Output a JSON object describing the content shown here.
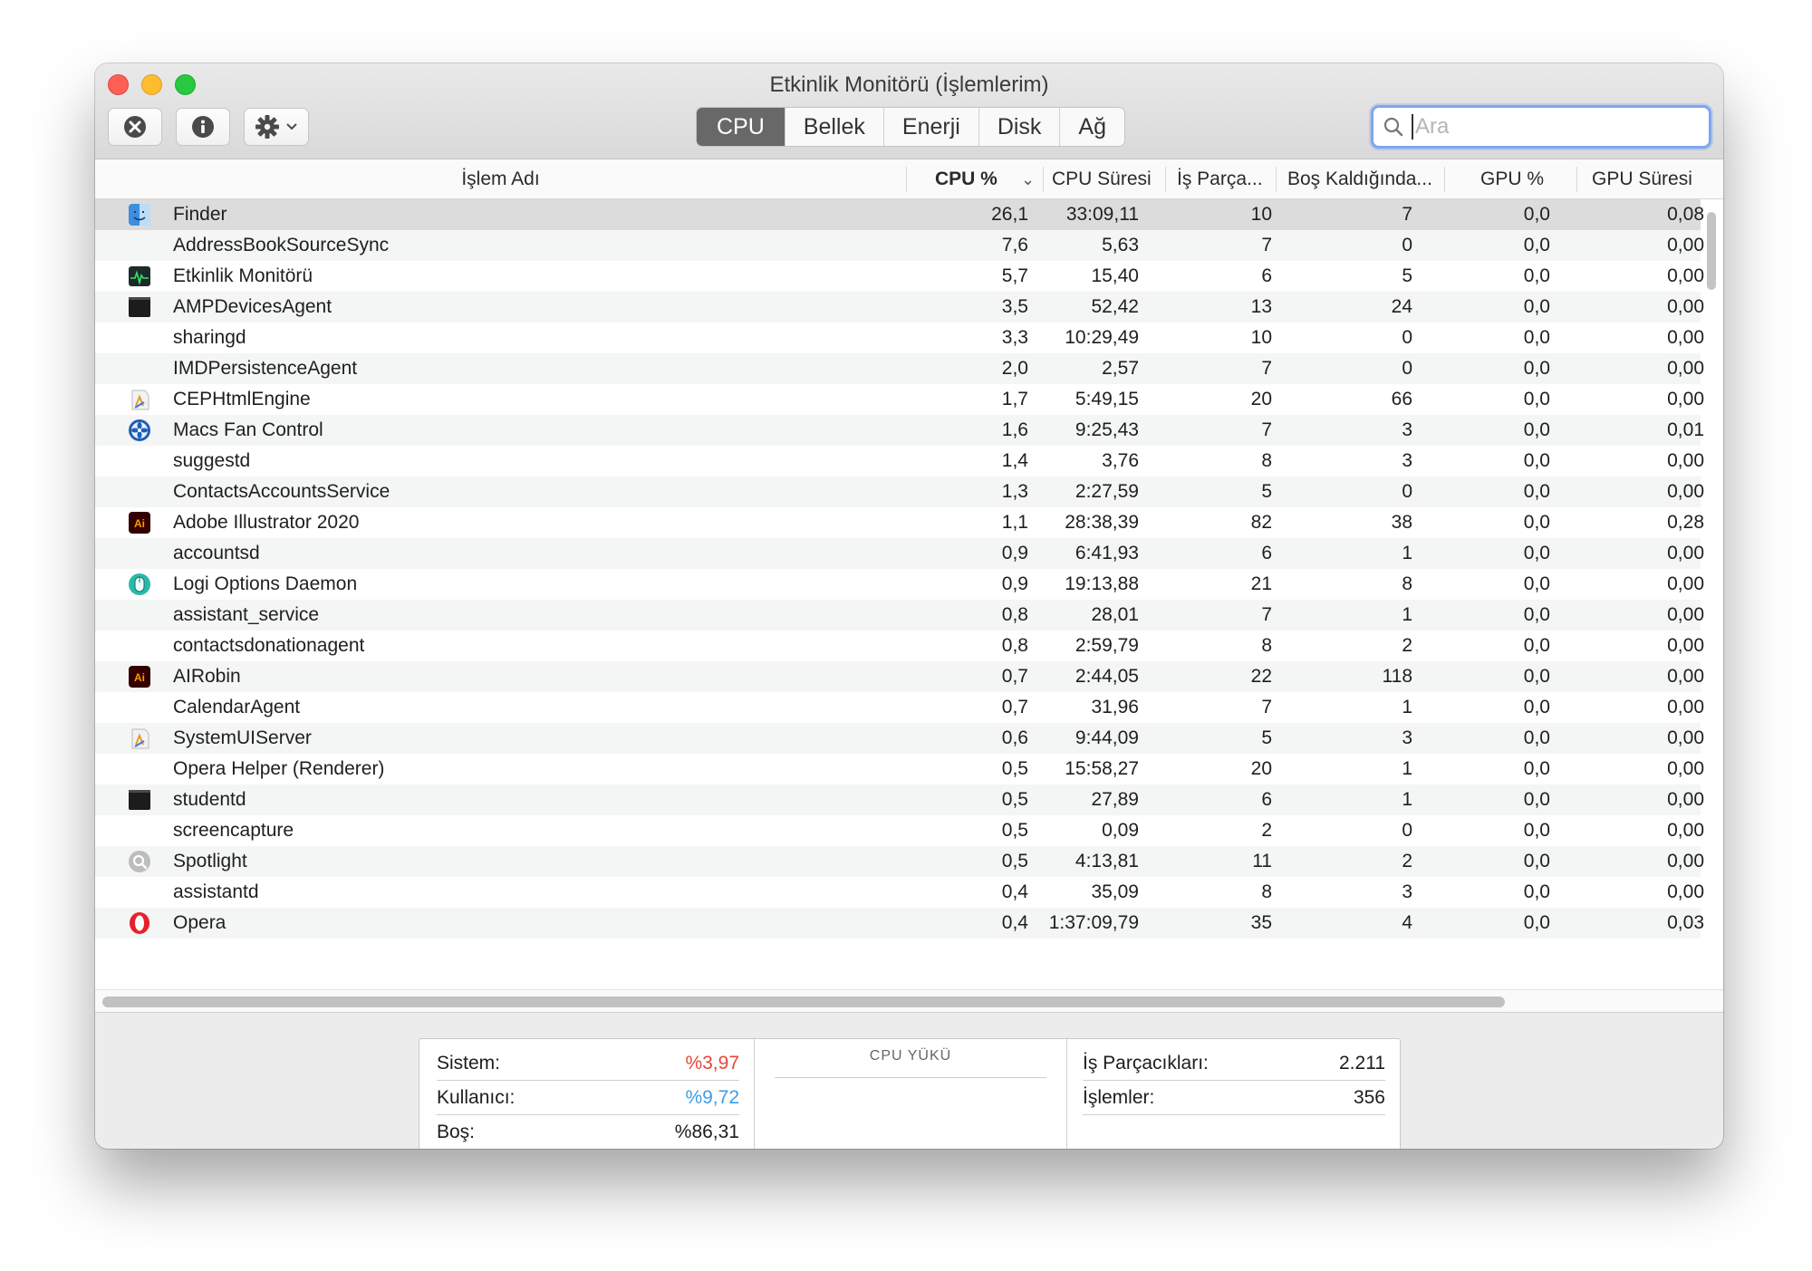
{
  "window": {
    "title": "Etkinlik Monitörü (İşlemlerim)"
  },
  "toolbar": {
    "stop_icon": "x-circle-icon",
    "info_icon": "info-icon",
    "gear_icon": "gear-icon"
  },
  "tabs": [
    {
      "label": "CPU",
      "active": true
    },
    {
      "label": "Bellek",
      "active": false
    },
    {
      "label": "Enerji",
      "active": false
    },
    {
      "label": "Disk",
      "active": false
    },
    {
      "label": "Ağ",
      "active": false
    }
  ],
  "search": {
    "placeholder": "Ara",
    "value": ""
  },
  "columns": {
    "name": "İşlem Adı",
    "cpu": "CPU %",
    "cpu_time": "CPU Süresi",
    "threads": "İş Parça...",
    "idle_wakeups": "Boş Kaldığında...",
    "gpu": "GPU %",
    "gpu_time": "GPU Süresi"
  },
  "processes": [
    {
      "name": "Finder",
      "icon": "finder-icon",
      "cpu": "26,1",
      "cpu_time": "33:09,11",
      "threads": "10",
      "idle": "7",
      "gpu": "0,0",
      "gpu_time": "0,08"
    },
    {
      "name": "AddressBookSourceSync",
      "icon": "",
      "cpu": "7,6",
      "cpu_time": "5,63",
      "threads": "7",
      "idle": "0",
      "gpu": "0,0",
      "gpu_time": "0,00"
    },
    {
      "name": "Etkinlik Monitörü",
      "icon": "activity-monitor-icon",
      "cpu": "5,7",
      "cpu_time": "15,40",
      "threads": "6",
      "idle": "5",
      "gpu": "0,0",
      "gpu_time": "0,00"
    },
    {
      "name": "AMPDevicesAgent",
      "icon": "terminal-icon",
      "cpu": "3,5",
      "cpu_time": "52,42",
      "threads": "13",
      "idle": "24",
      "gpu": "0,0",
      "gpu_time": "0,00"
    },
    {
      "name": "sharingd",
      "icon": "",
      "cpu": "3,3",
      "cpu_time": "10:29,49",
      "threads": "10",
      "idle": "0",
      "gpu": "0,0",
      "gpu_time": "0,00"
    },
    {
      "name": "IMDPersistenceAgent",
      "icon": "",
      "cpu": "2,0",
      "cpu_time": "2,57",
      "threads": "7",
      "idle": "0",
      "gpu": "0,0",
      "gpu_time": "0,00"
    },
    {
      "name": "CEPHtmlEngine",
      "icon": "app-generic-icon",
      "cpu": "1,7",
      "cpu_time": "5:49,15",
      "threads": "20",
      "idle": "66",
      "gpu": "0,0",
      "gpu_time": "0,00"
    },
    {
      "name": "Macs Fan Control",
      "icon": "fan-icon",
      "cpu": "1,6",
      "cpu_time": "9:25,43",
      "threads": "7",
      "idle": "3",
      "gpu": "0,0",
      "gpu_time": "0,01"
    },
    {
      "name": "suggestd",
      "icon": "",
      "cpu": "1,4",
      "cpu_time": "3,76",
      "threads": "8",
      "idle": "3",
      "gpu": "0,0",
      "gpu_time": "0,00"
    },
    {
      "name": "ContactsAccountsService",
      "icon": "",
      "cpu": "1,3",
      "cpu_time": "2:27,59",
      "threads": "5",
      "idle": "0",
      "gpu": "0,0",
      "gpu_time": "0,00"
    },
    {
      "name": "Adobe Illustrator 2020",
      "icon": "illustrator-icon",
      "cpu": "1,1",
      "cpu_time": "28:38,39",
      "threads": "82",
      "idle": "38",
      "gpu": "0,0",
      "gpu_time": "0,28"
    },
    {
      "name": "accountsd",
      "icon": "",
      "cpu": "0,9",
      "cpu_time": "6:41,93",
      "threads": "6",
      "idle": "1",
      "gpu": "0,0",
      "gpu_time": "0,00"
    },
    {
      "name": "Logi Options Daemon",
      "icon": "mouse-icon",
      "cpu": "0,9",
      "cpu_time": "19:13,88",
      "threads": "21",
      "idle": "8",
      "gpu": "0,0",
      "gpu_time": "0,00"
    },
    {
      "name": "assistant_service",
      "icon": "",
      "cpu": "0,8",
      "cpu_time": "28,01",
      "threads": "7",
      "idle": "1",
      "gpu": "0,0",
      "gpu_time": "0,00"
    },
    {
      "name": "contactsdonationagent",
      "icon": "",
      "cpu": "0,8",
      "cpu_time": "2:59,79",
      "threads": "8",
      "idle": "2",
      "gpu": "0,0",
      "gpu_time": "0,00"
    },
    {
      "name": "AIRobin",
      "icon": "illustrator-icon",
      "cpu": "0,7",
      "cpu_time": "2:44,05",
      "threads": "22",
      "idle": "118",
      "gpu": "0,0",
      "gpu_time": "0,00"
    },
    {
      "name": "CalendarAgent",
      "icon": "",
      "cpu": "0,7",
      "cpu_time": "31,96",
      "threads": "7",
      "idle": "1",
      "gpu": "0,0",
      "gpu_time": "0,00"
    },
    {
      "name": "SystemUIServer",
      "icon": "app-generic-icon",
      "cpu": "0,6",
      "cpu_time": "9:44,09",
      "threads": "5",
      "idle": "3",
      "gpu": "0,0",
      "gpu_time": "0,00"
    },
    {
      "name": "Opera Helper (Renderer)",
      "icon": "",
      "cpu": "0,5",
      "cpu_time": "15:58,27",
      "threads": "20",
      "idle": "1",
      "gpu": "0,0",
      "gpu_time": "0,00"
    },
    {
      "name": "studentd",
      "icon": "terminal-icon",
      "cpu": "0,5",
      "cpu_time": "27,89",
      "threads": "6",
      "idle": "1",
      "gpu": "0,0",
      "gpu_time": "0,00"
    },
    {
      "name": "screencapture",
      "icon": "",
      "cpu": "0,5",
      "cpu_time": "0,09",
      "threads": "2",
      "idle": "0",
      "gpu": "0,0",
      "gpu_time": "0,00"
    },
    {
      "name": "Spotlight",
      "icon": "spotlight-icon",
      "cpu": "0,5",
      "cpu_time": "4:13,81",
      "threads": "11",
      "idle": "2",
      "gpu": "0,0",
      "gpu_time": "0,00"
    },
    {
      "name": "assistantd",
      "icon": "",
      "cpu": "0,4",
      "cpu_time": "35,09",
      "threads": "8",
      "idle": "3",
      "gpu": "0,0",
      "gpu_time": "0,00"
    },
    {
      "name": "Opera",
      "icon": "opera-icon",
      "cpu": "0,4",
      "cpu_time": "1:37:09,79",
      "threads": "35",
      "idle": "4",
      "gpu": "0,0",
      "gpu_time": "0,03"
    }
  ],
  "summary": {
    "system_label": "Sistem:",
    "system_value": "%3,97",
    "user_label": "Kullanıcı:",
    "user_value": "%9,72",
    "idle_label": "Boş:",
    "idle_value": "%86,31",
    "load_title": "CPU YÜKÜ",
    "threads_label": "İş Parçacıkları:",
    "threads_value": "2.211",
    "processes_label": "İşlemler:",
    "processes_value": "356"
  },
  "colors": {
    "system": "#e5473b",
    "user": "#3a9ee8",
    "selected_tab": "#686868",
    "search_focus": "#7ea6ef"
  }
}
